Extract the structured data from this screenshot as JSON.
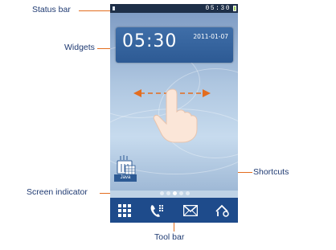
{
  "callouts": {
    "status_bar": "Status bar",
    "widgets": "Widgets",
    "shortcuts": "Shortcuts",
    "screen_indicator": "Screen indicator",
    "tool_bar": "Tool bar"
  },
  "status_bar": {
    "time": "05:30"
  },
  "clock_widget": {
    "time": "05:30",
    "date": "2011-01-07"
  },
  "shortcut": {
    "label": "Java",
    "icon": "java-icon"
  },
  "screen_indicator": {
    "count": 5,
    "active_index": 2
  },
  "toolbar": {
    "items": [
      {
        "icon": "app-grid-icon"
      },
      {
        "icon": "dialer-icon"
      },
      {
        "icon": "message-icon"
      },
      {
        "icon": "home-gear-icon"
      }
    ]
  },
  "colors": {
    "callout_text": "#1f3a72",
    "leader_line": "#e36d1f",
    "toolbar": "#1e4b8b",
    "status_bar": "#1e2f48"
  }
}
